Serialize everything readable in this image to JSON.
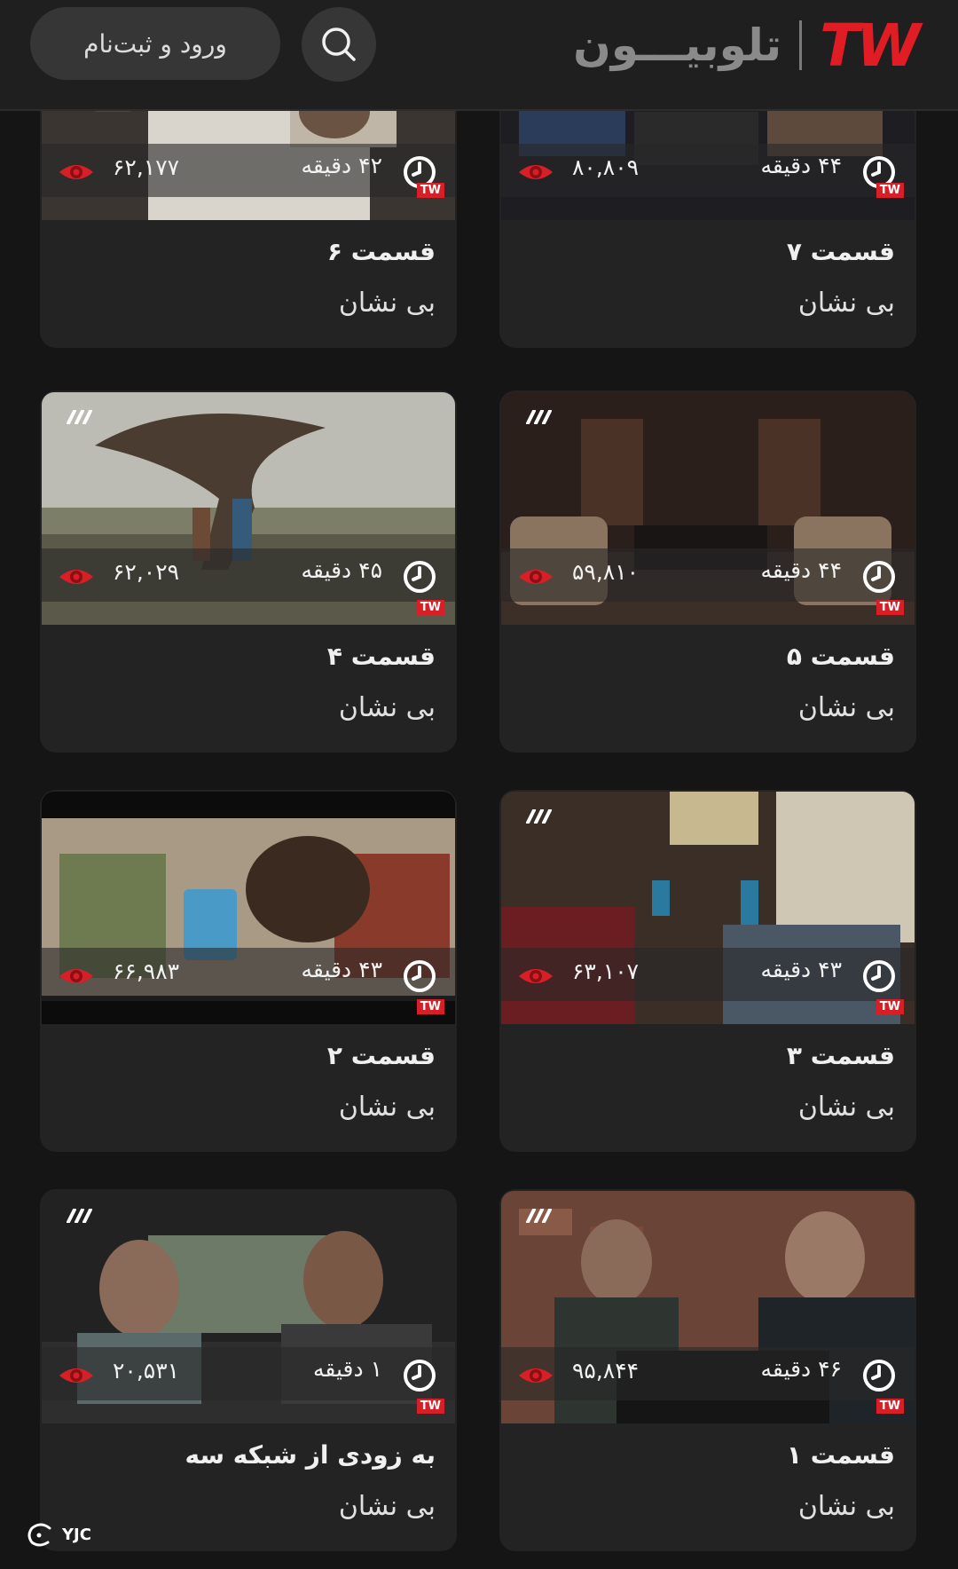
{
  "header": {
    "login_label": "ورود و ثبت‌نام",
    "brand_name": "تلوبیـــون",
    "brand_logo": "TW",
    "brand_color": "#e01c24"
  },
  "cards": [
    {
      "title": "قسمت ۶",
      "series": "بی نشان",
      "duration": "۴۲ دقیقه",
      "views": "۶۲,۱۷۷",
      "badge": "TW"
    },
    {
      "title": "قسمت ۷",
      "series": "بی نشان",
      "duration": "۴۴ دقیقه",
      "views": "۸۰,۸۰۹",
      "badge": "TW"
    },
    {
      "title": "قسمت ۴",
      "series": "بی نشان",
      "duration": "۴۵ دقیقه",
      "views": "۶۲,۰۲۹",
      "badge": "TW"
    },
    {
      "title": "قسمت ۵",
      "series": "بی نشان",
      "duration": "۴۴ دقیقه",
      "views": "۵۹,۸۱۰",
      "badge": "TW"
    },
    {
      "title": "قسمت ۲",
      "series": "بی نشان",
      "duration": "۴۳ دقیقه",
      "views": "۶۶,۹۸۳",
      "badge": "TW"
    },
    {
      "title": "قسمت ۳",
      "series": "بی نشان",
      "duration": "۴۳ دقیقه",
      "views": "۶۳,۱۰۷",
      "badge": "TW"
    },
    {
      "title": "به زودی از شبکه سه",
      "series": "بی نشان",
      "duration": "۱ دقیقه",
      "views": "۲۰,۵۳۱",
      "badge": "TW"
    },
    {
      "title": "قسمت ۱",
      "series": "بی نشان",
      "duration": "۴۶ دقیقه",
      "views": "۹۵,۸۴۴",
      "badge": "TW"
    }
  ],
  "watermark": {
    "text": "YJC"
  },
  "colors": {
    "accent_red": "#d61f26",
    "card_bg": "#232323",
    "page_bg": "#151515"
  }
}
